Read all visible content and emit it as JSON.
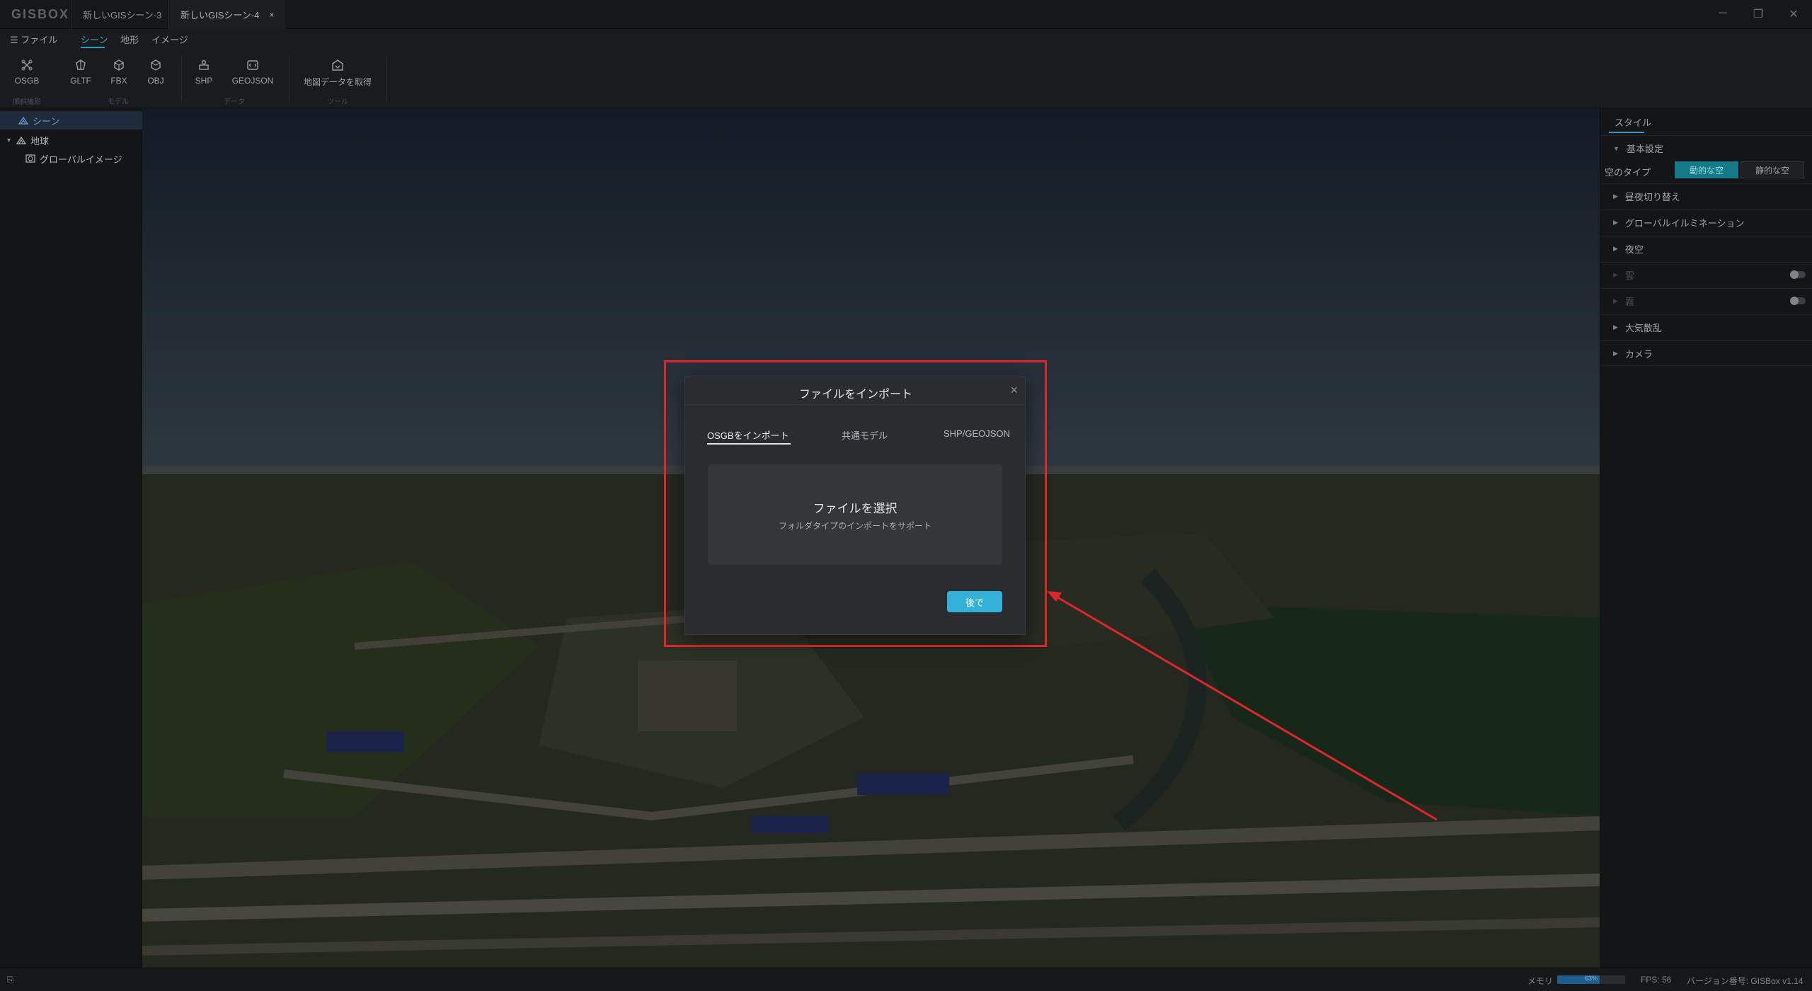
{
  "app": {
    "logo": "GISBOX",
    "tabs": [
      {
        "label": "新しいGISシーン-3",
        "mark": "●"
      },
      {
        "label": "新しいGISシーン-4",
        "mark": "×"
      }
    ],
    "window_controls": {
      "minimize": "─",
      "restore": "❐",
      "close": "✕"
    }
  },
  "menu": {
    "items": [
      "☰ ファイル",
      "シーン",
      "地形",
      "イメージ"
    ],
    "active_index": 1
  },
  "toolbar": {
    "tools": [
      {
        "label": "OSGB",
        "icon": "osgb-icon"
      },
      {
        "label": "GLTF",
        "icon": "gltf-icon"
      },
      {
        "label": "FBX",
        "icon": "fbx-icon"
      },
      {
        "label": "OBJ",
        "icon": "obj-icon"
      },
      {
        "label": "SHP",
        "icon": "shp-icon"
      },
      {
        "label": "GEOJSON",
        "icon": "geojson-icon"
      },
      {
        "label": "地図データを取得",
        "icon": "download-map-icon"
      }
    ],
    "groups": [
      "傾斜撮影",
      "モデル",
      "データ",
      "ツール"
    ]
  },
  "tree": {
    "items": [
      {
        "label": "シーン",
        "icon": "scene-icon",
        "selected": true
      },
      {
        "label": "地球",
        "icon": "globe-icon",
        "expand": "▾"
      },
      {
        "label": "グローバルイメージ",
        "icon": "image-layer-icon"
      }
    ]
  },
  "right_panel": {
    "tab": "スタイル",
    "basic_section": "基本設定",
    "sky_type_label": "空のタイプ",
    "sky_options": [
      "動的な空",
      "静的な空"
    ],
    "sky_selected_index": 0,
    "sections": [
      {
        "label": "昼夜切り替え",
        "disabled": false
      },
      {
        "label": "グローバルイルミネーション",
        "disabled": false
      },
      {
        "label": "夜空",
        "disabled": false
      },
      {
        "label": "雲",
        "disabled": true,
        "toggle": false
      },
      {
        "label": "霧",
        "disabled": true,
        "toggle": false
      },
      {
        "label": "大気散乱",
        "disabled": false
      },
      {
        "label": "カメラ",
        "disabled": false
      }
    ]
  },
  "dialog": {
    "title": "ファイルをインポート",
    "close": "×",
    "tabs": [
      "OSGBをインポート",
      "共通モデル",
      "SHP/GEOJSON"
    ],
    "active_tab": 0,
    "dropzone_title": "ファイルを選択",
    "dropzone_subtitle": "フォルダタイプのインポートをサポート",
    "later_button": "後で"
  },
  "status": {
    "memory_label": "メモリ",
    "memory_percent": 63,
    "memory_text": "63%",
    "fps": "FPS: 56",
    "version": "バージョン番号: GISBox v1.14"
  },
  "colors": {
    "accent": "#34b1d8",
    "highlight": "#e0262a",
    "selected_tree": "#1f2a3a"
  }
}
